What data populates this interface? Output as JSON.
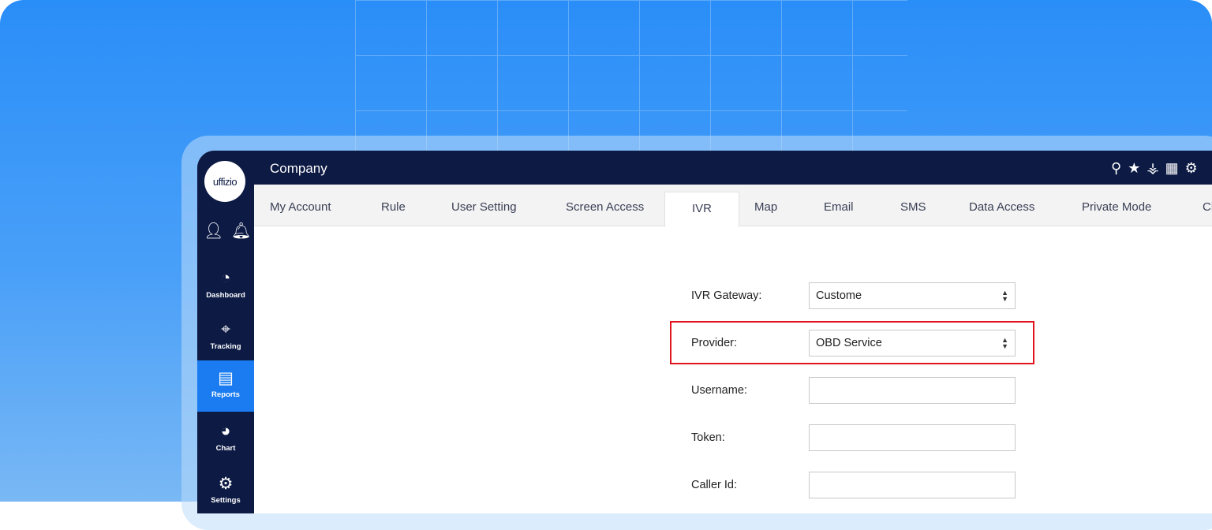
{
  "header": {
    "title": "Company",
    "icons": [
      "search-icon",
      "star-icon",
      "filter-settings-icon",
      "calendar-clock-icon",
      "gear-icon"
    ]
  },
  "logo": "uffizio",
  "sidebar": {
    "items": [
      {
        "label": "Dashboard",
        "icon": "◔"
      },
      {
        "label": "Tracking",
        "icon": "⌖"
      },
      {
        "label": "Reports",
        "icon": "▤"
      },
      {
        "label": "Chart",
        "icon": "◕"
      },
      {
        "label": "Settings",
        "icon": "⚙"
      }
    ],
    "active": "Reports"
  },
  "tabs": [
    "My Account",
    "Rule",
    "User Setting",
    "Screen Access",
    "IVR",
    "Map",
    "Email",
    "SMS",
    "Data Access",
    "Private Mode",
    "Cl"
  ],
  "active_tab": "IVR",
  "form": {
    "ivr_gateway": {
      "label": "IVR Gateway:",
      "value": "Custome"
    },
    "provider": {
      "label": "Provider:",
      "value": "OBD Service"
    },
    "username": {
      "label": "Username:",
      "value": ""
    },
    "token": {
      "label": "Token:",
      "value": ""
    },
    "caller_id": {
      "label": "Caller Id:",
      "value": ""
    }
  },
  "highlight_color": "#e0141e"
}
